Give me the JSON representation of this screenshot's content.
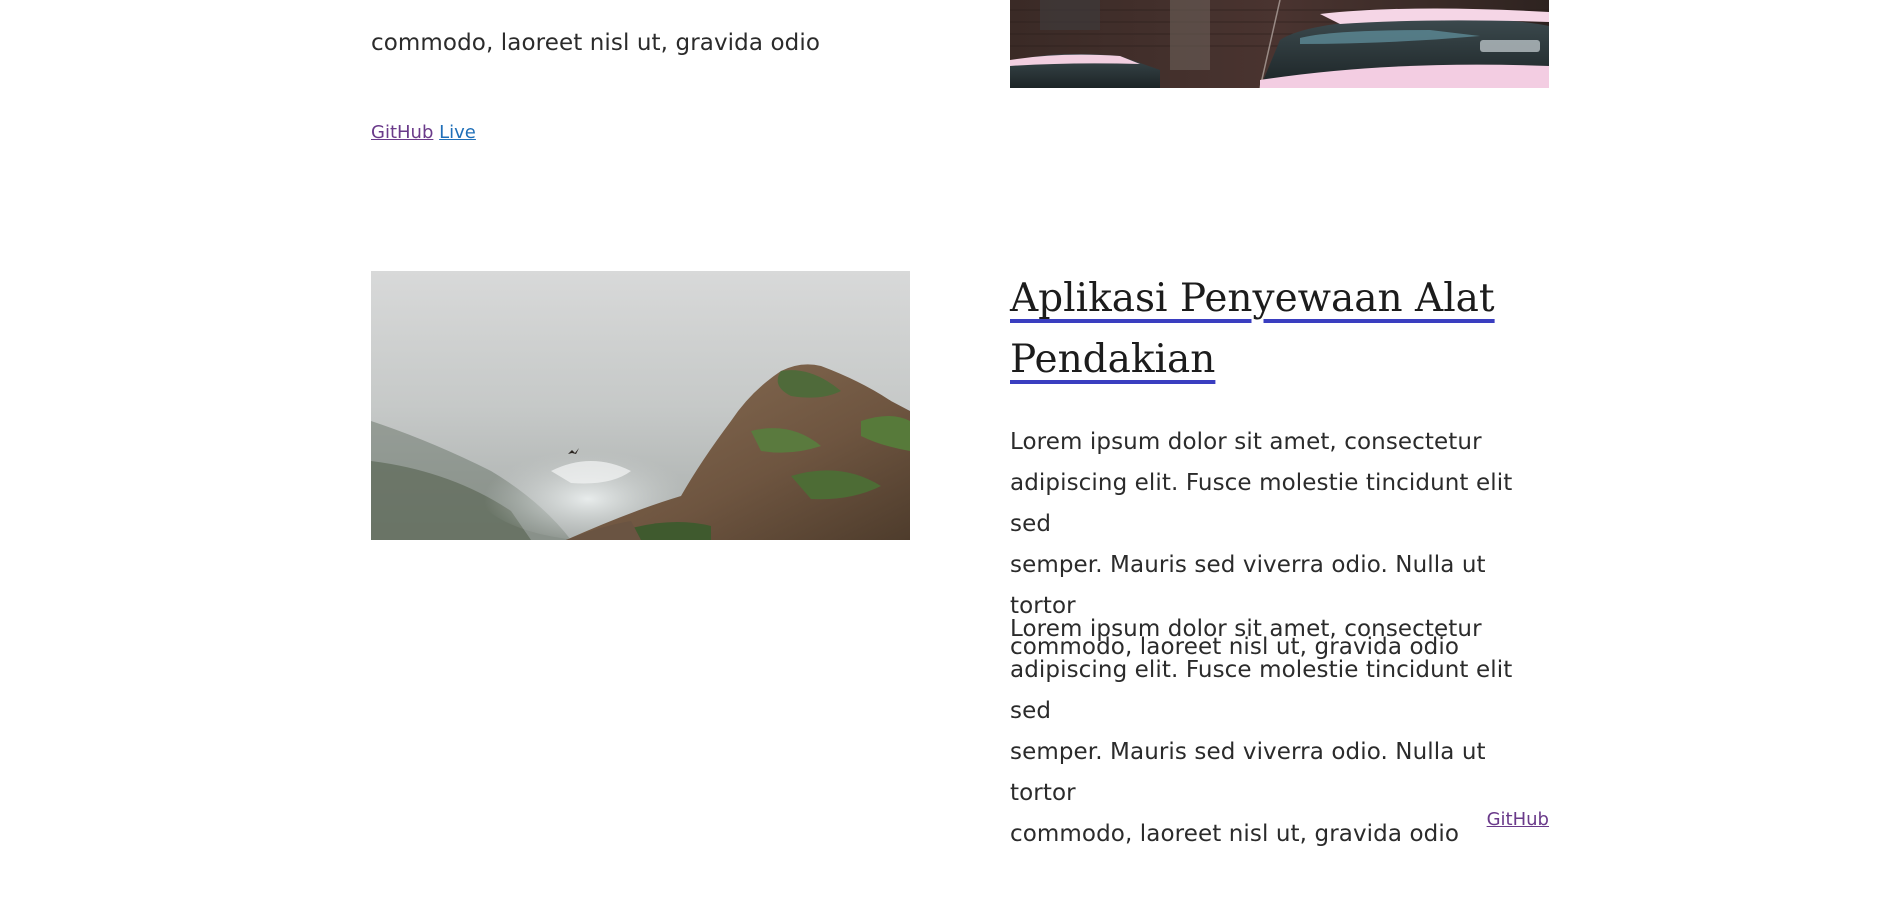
{
  "top_project": {
    "description_tail": "commodo, laoreet nisl ut, gravida odio",
    "github_label": "GitHub",
    "live_label": "Live"
  },
  "project": {
    "title_line1": "Aplikasi Penyewaan Alat",
    "title_line2": "Pendakian",
    "paragraphs": [
      [
        "Lorem ipsum dolor sit amet, consectetur",
        "adipiscing elit. Fusce molestie tincidunt elit sed",
        "semper. Mauris sed viverra odio. Nulla ut tortor",
        "commodo, laoreet nisl ut, gravida odio"
      ],
      [
        "Lorem ipsum dolor sit amet, consectetur",
        "adipiscing elit. Fusce molestie tincidunt elit sed",
        "semper. Mauris sed viverra odio. Nulla ut tortor",
        "commodo, laoreet nisl ut, gravida odio"
      ]
    ],
    "github_label": "GitHub"
  },
  "colors": {
    "title_underline": "#3a3ec0",
    "link_visited": "#6a3a8a",
    "link_new": "#1f6fb8"
  }
}
